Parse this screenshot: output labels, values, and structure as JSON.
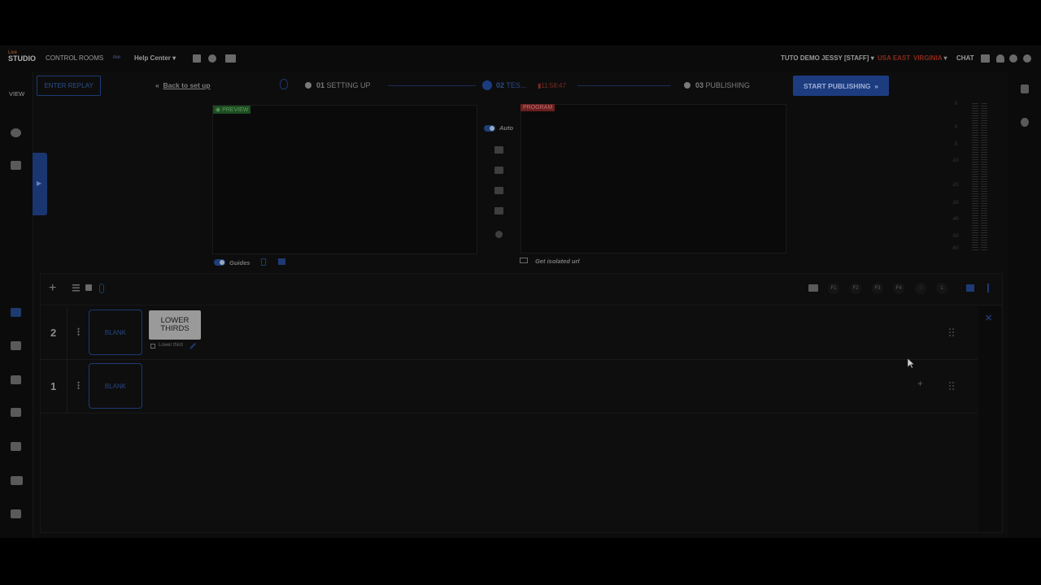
{
  "header": {
    "logo_top": "Live",
    "logo_main": "STUDIO",
    "control_rooms": "CONTROL ROOMS",
    "room_tag": "live",
    "help_center": "Help Center",
    "user": "TUTO DEMO JESSY [STAFF]",
    "region": "USA EAST",
    "region_city": "VIRGINIA",
    "chat": "CHAT"
  },
  "left_nav": {
    "view_label": "VIEW"
  },
  "steps": {
    "enter_replay": "ENTER REPLAY",
    "back": "Back to set up",
    "step1_num": "01",
    "step1_label": "SETTING UP",
    "step2_num": "02",
    "step2_label": "TES...",
    "step2_timer": "11:58:47",
    "step3_num": "03",
    "step3_label": "PUBLISHING",
    "start_publishing": "START PUBLISHING"
  },
  "preview": {
    "tag": "PREVIEW",
    "guides": "Guides"
  },
  "program": {
    "tag": "PROGRAM",
    "isolated": "Get isolated url"
  },
  "transition": {
    "auto": "Auto"
  },
  "audio_meter": {
    "labels": [
      "0",
      "0",
      "-5",
      "-10",
      "-20",
      "-30",
      "-40",
      "-50",
      "-60"
    ]
  },
  "toolbar": {
    "keys": [
      "F1",
      "F2",
      "F3",
      "F4",
      "0",
      "1"
    ]
  },
  "layers": [
    {
      "number": "2",
      "blank": "BLANK",
      "item_title": "LOWER THIRDS",
      "item_caption": "Lower third"
    },
    {
      "number": "1",
      "blank": "BLANK"
    }
  ],
  "colors": {
    "accent": "#1d3c80",
    "preview": "#1d4d22",
    "program": "#6b1f1f",
    "region": "#8a2a1a"
  }
}
